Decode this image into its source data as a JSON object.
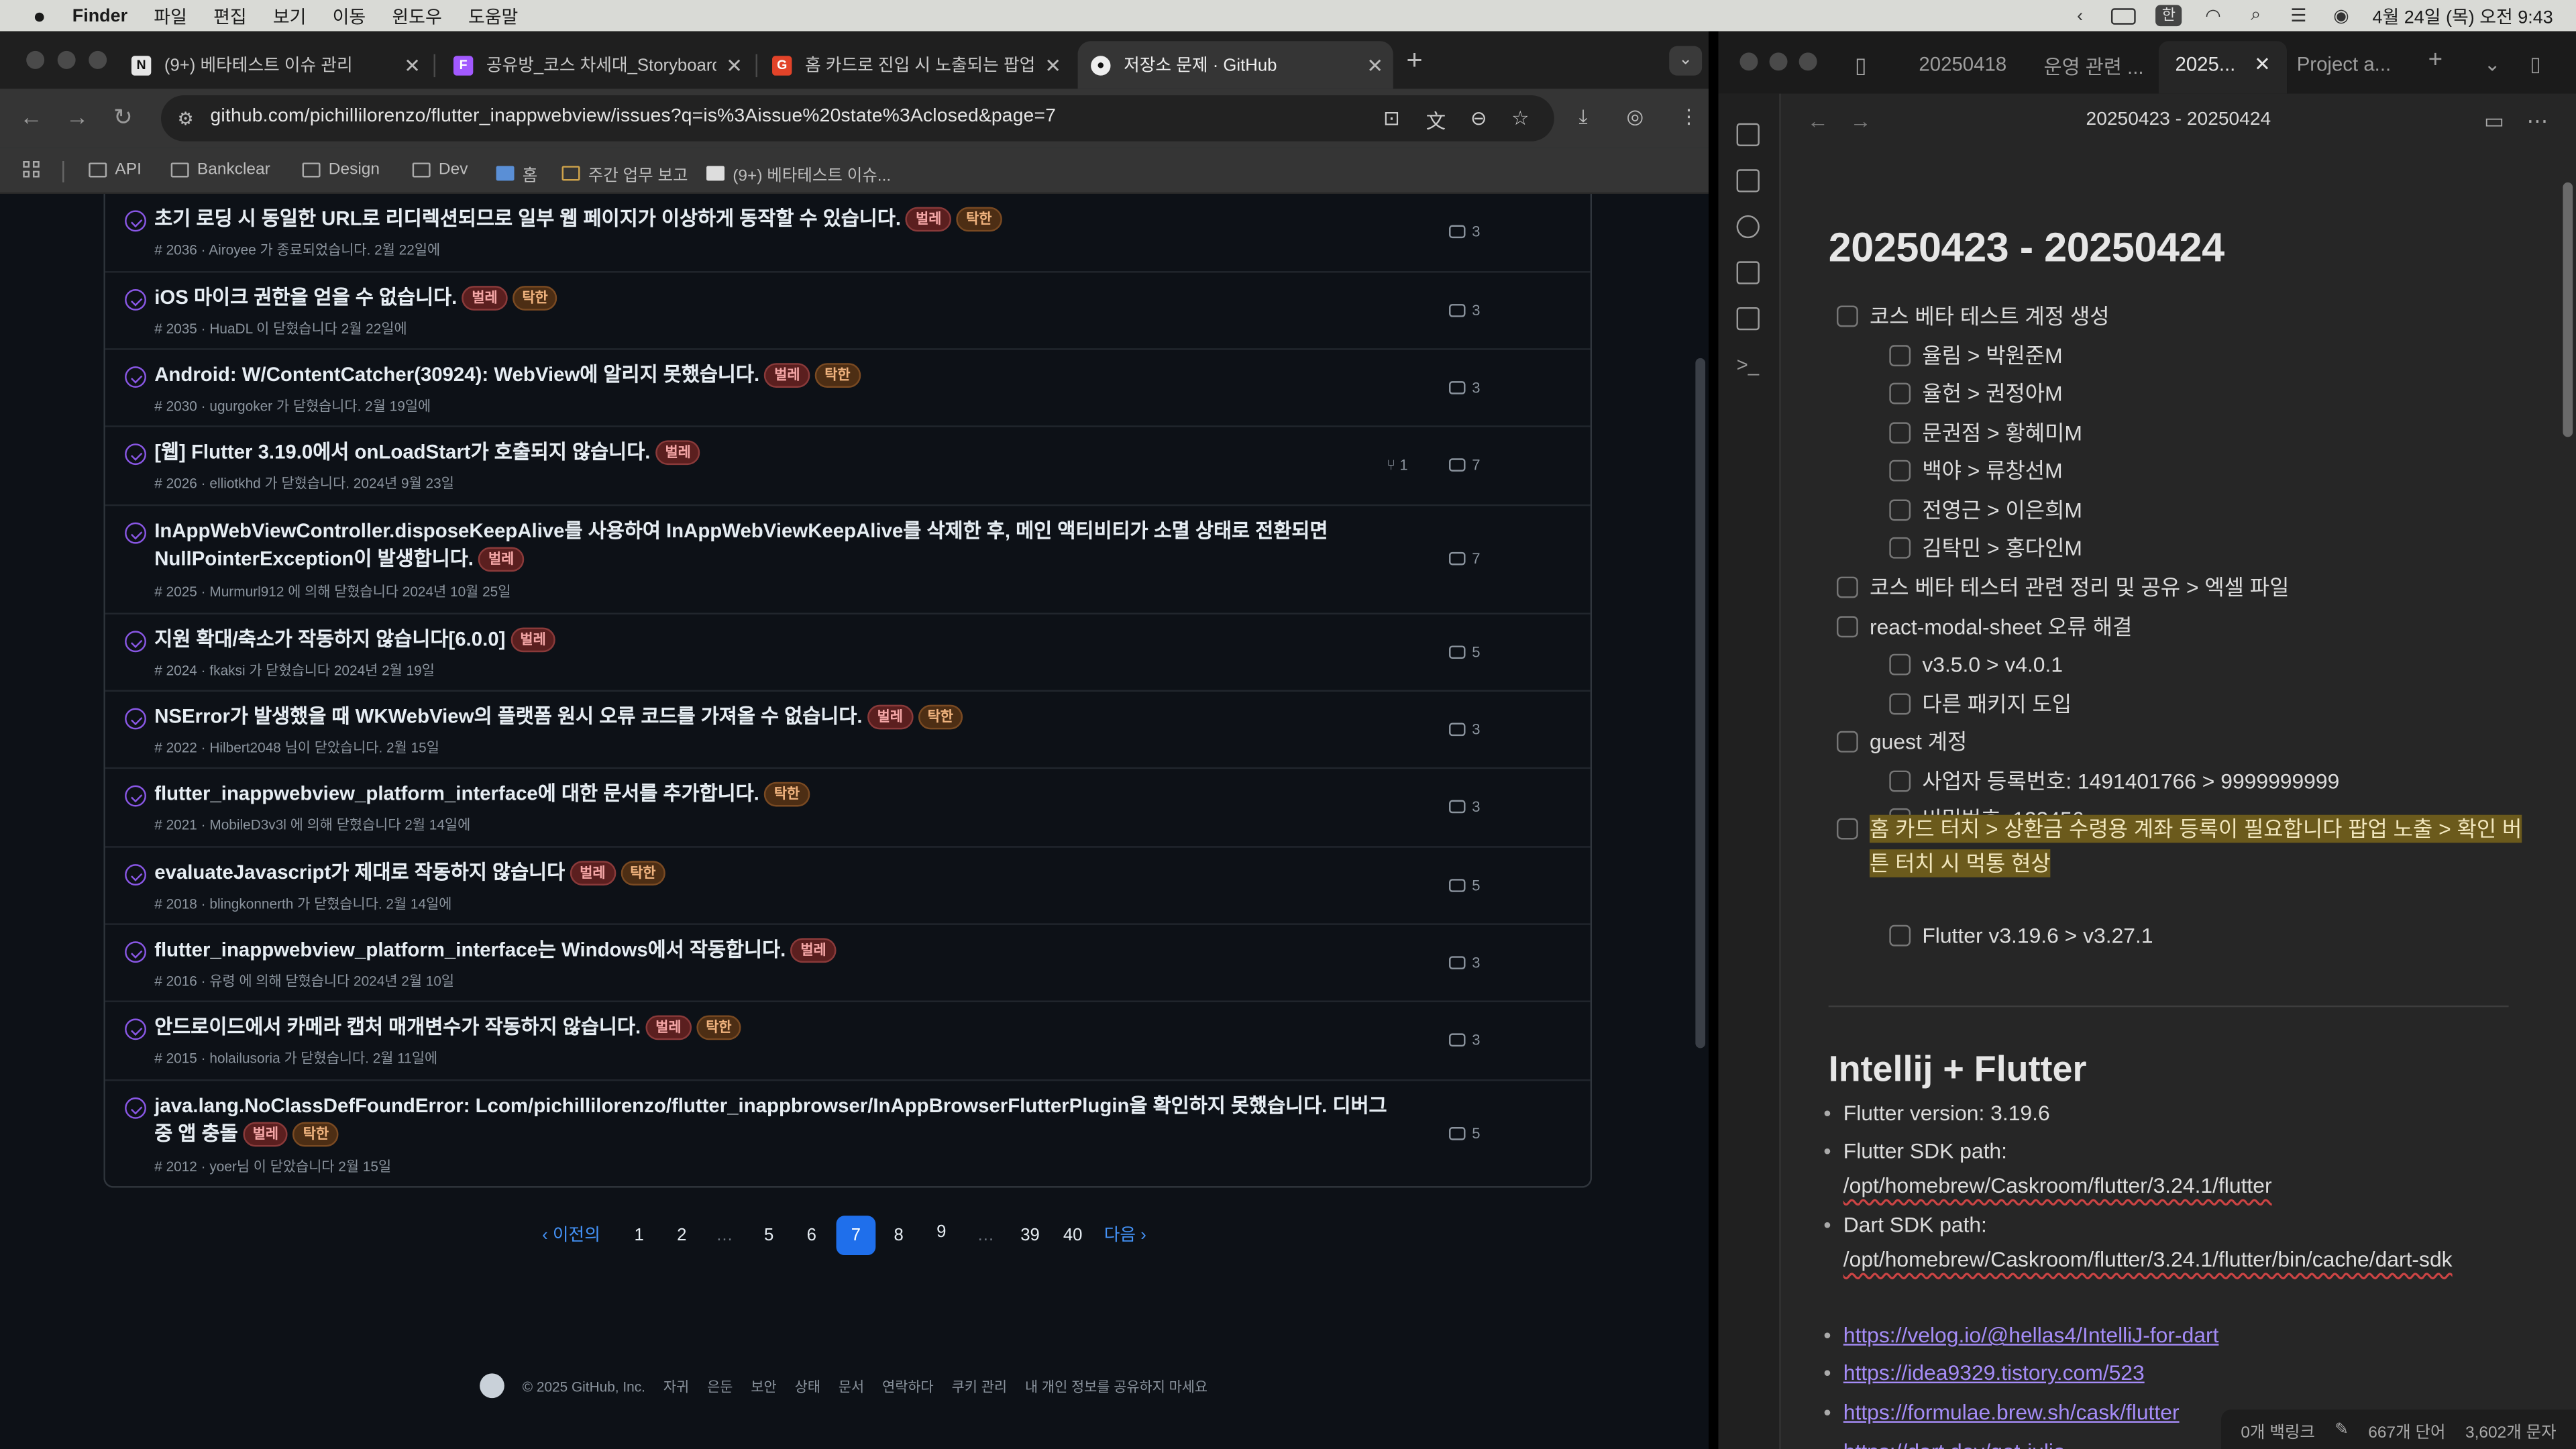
{
  "menubar": {
    "app": "Finder",
    "items": [
      "파일",
      "편집",
      "보기",
      "이동",
      "윈도우",
      "도움말"
    ],
    "datetime": "4월 24일 (목) 오전 9:43"
  },
  "chrome": {
    "tabs": [
      {
        "title": "(9+) 베타테스트 이슈 관리",
        "fav": "N"
      },
      {
        "title": "공유방_코스 차세대_Storyboard",
        "fav": "F"
      },
      {
        "title": "홈 카드로 진입 시 노출되는 팝업",
        "fav": "G"
      },
      {
        "title": "저장소 문제 · GitHub",
        "fav": "●"
      }
    ],
    "url": "github.com/pichillilorenzo/flutter_inappwebview/issues?q=is%3Aissue%20state%3Aclosed&page=7",
    "bookmarks": [
      "API",
      "Bankclear",
      "Design",
      "Dev",
      "홈",
      "주간 업무 보고",
      "(9+) 베타테스트 이슈..."
    ]
  },
  "issues": [
    {
      "title": "초기 로딩 시 동일한 URL로 리디렉션되므로 일부 웹 페이지가 이상하게 동작할 수 있습니다.",
      "labels": [
        "벌레",
        "탁한"
      ],
      "meta": "# 2036 · Airoyee 가 종료되었습니다. 2월 22일에",
      "comments": "3",
      "pr": ""
    },
    {
      "title": "iOS 마이크 권한을 얻을 수 없습니다.",
      "labels": [
        "벌레",
        "탁한"
      ],
      "meta": "# 2035 · HuaDL 이 닫혔습니다 2월 22일에",
      "comments": "3",
      "pr": ""
    },
    {
      "title": "Android: W/ContentCatcher(30924): WebView에 알리지 못했습니다.",
      "labels": [
        "벌레",
        "탁한"
      ],
      "meta": "# 2030 · ugurgoker 가 닫혔습니다. 2월 19일에",
      "comments": "3",
      "pr": ""
    },
    {
      "title": "[웹] Flutter 3.19.0에서 onLoadStart가 호출되지 않습니다.",
      "labels": [
        "벌레"
      ],
      "meta": "# 2026 · elliotkhd 가 닫혔습니다. 2024년 9월 23일",
      "comments": "7",
      "pr": "1"
    },
    {
      "title": "InAppWebViewController.disposeKeepAlive를 사용하여 InAppWebViewKeepAlive를 삭제한 후, 메인 액티비티가 소멸 상태로 전환되면 NullPointerException이 발생합니다.",
      "labels": [
        "벌레"
      ],
      "meta": "# 2025 · Murmurl912 에 의해 닫혔습니다 2024년 10월 25일",
      "comments": "7",
      "pr": ""
    },
    {
      "title": "지원 확대/축소가 작동하지 않습니다[6.0.0]",
      "labels": [
        "벌레"
      ],
      "meta": "# 2024 · fkaksi 가 닫혔습니다 2024년 2월 19일",
      "comments": "5",
      "pr": ""
    },
    {
      "title": "NSError가 발생했을 때 WKWebView의 플랫폼 원시 오류 코드를 가져올 수 없습니다.",
      "labels": [
        "벌레",
        "탁한"
      ],
      "meta": "# 2022 · Hilbert2048 님이 닫았습니다. 2월 15일",
      "comments": "3",
      "pr": ""
    },
    {
      "title": "flutter_inappwebview_platform_interface에 대한 문서를 추가합니다.",
      "labels": [
        "탁한"
      ],
      "meta": "# 2021 · MobileD3v3l 에 의해 닫혔습니다 2월 14일에",
      "comments": "3",
      "pr": ""
    },
    {
      "title": "evaluateJavascript가 제대로 작동하지 않습니다",
      "labels": [
        "벌레",
        "탁한"
      ],
      "meta": "# 2018 · blingkonnerth 가 닫혔습니다. 2월 14일에",
      "comments": "5",
      "pr": ""
    },
    {
      "title": "flutter_inappwebview_platform_interface는 Windows에서 작동합니다.",
      "labels": [
        "벌레"
      ],
      "meta": "# 2016 · 유령 에 의해 닫혔습니다 2024년 2월 10일",
      "comments": "3",
      "pr": ""
    },
    {
      "title": "안드로이드에서 카메라 캡처 매개변수가 작동하지 않습니다.",
      "labels": [
        "벌레",
        "탁한"
      ],
      "meta": "# 2015 · holailusoria 가 닫혔습니다. 2월 11일에",
      "comments": "3",
      "pr": ""
    },
    {
      "title": "java.lang.NoClassDefFoundError: Lcom/pichillilorenzo/flutter_inappbrowser/InAppBrowserFlutterPlugin을 확인하지 못했습니다. 디버그 중 앱 충돌",
      "labels": [
        "벌레",
        "탁한"
      ],
      "meta": "# 2012 · yoer님 이 닫았습니다 2월 15일",
      "comments": "5",
      "pr": ""
    }
  ],
  "pagination": {
    "prev": "이전의",
    "pages": [
      "1",
      "2",
      "…",
      "5",
      "6",
      "7",
      "8",
      "9",
      "…",
      "39",
      "40"
    ],
    "current": "7",
    "next": "다음"
  },
  "footer": {
    "copyright": "© 2025 GitHub, Inc.",
    "links": [
      "자귀",
      "은둔",
      "보안",
      "상태",
      "문서",
      "연락하다",
      "쿠키 관리",
      "내 개인 정보를 공유하지 마세요"
    ]
  },
  "obsidian": {
    "tabs": [
      "20250418",
      "운영 관련 ...",
      "2025...",
      "Project a..."
    ],
    "header_title": "20250423 - 20250424",
    "h1": "20250423 - 20250424",
    "todos": [
      {
        "text": "코스 베타 테스트 계정 생성",
        "level": 0
      },
      {
        "text": "율림 > 박원준M",
        "level": 1
      },
      {
        "text": "율헌 > 권정아M",
        "level": 1
      },
      {
        "text": "문권점 > 황혜미M",
        "level": 1
      },
      {
        "text": "백야 > 류창선M",
        "level": 1
      },
      {
        "text": "전영근 > 이은희M",
        "level": 1
      },
      {
        "text": "김탁민 > 홍다인M",
        "level": 1
      },
      {
        "text": "코스 베타 테스터 관련 정리 및 공유 > 엑셀 파일",
        "level": 0
      },
      {
        "text": "react-modal-sheet 오류 해결",
        "level": 0
      },
      {
        "text": "v3.5.0 > v4.0.1",
        "level": 1
      },
      {
        "text": "다른 패키지 도입",
        "level": 1
      },
      {
        "text": "guest 계정",
        "level": 0
      },
      {
        "text": "사업자 등록번호: 1491401766 > 9999999999",
        "level": 1
      },
      {
        "text": "비밀번호: 123456",
        "level": 1
      }
    ],
    "highlight_todo": "홈 카드 터치 > 상환금 수령용 계좌 등록이 필요합니다 팝업 노출 > 확인 버튼 터치 시 먹통 현상",
    "sub_todo": "Flutter v3.19.6 > v3.27.1",
    "h2": "Intellij + Flutter",
    "bullets": {
      "version": "Flutter version: 3.19.6",
      "flutter_sdk_label": "Flutter SDK path:",
      "flutter_sdk_path": "/opt/homebrew/Caskroom/flutter/3.24.1/flutter",
      "dart_sdk_label": "Dart SDK path:",
      "dart_sdk_path": "/opt/homebrew/Caskroom/flutter/3.24.1/flutter/bin/cache/dart-sdk",
      "links": [
        "https://velog.io/@hellas4/IntelliJ-for-dart",
        "https://idea9329.tistory.com/523",
        "https://formulae.brew.sh/cask/flutter",
        "https://dart.dev/get-julia"
      ]
    },
    "status": {
      "backlinks": "0개 백링크",
      "words": "667개 단어",
      "chars": "3,602개 문자"
    }
  },
  "colors": {
    "github_bg": "#0d1117",
    "accent": "#1f6feb",
    "link": "#4493f8",
    "closed_icon": "#8957e5",
    "obsidian_link": "#a58cf7"
  }
}
